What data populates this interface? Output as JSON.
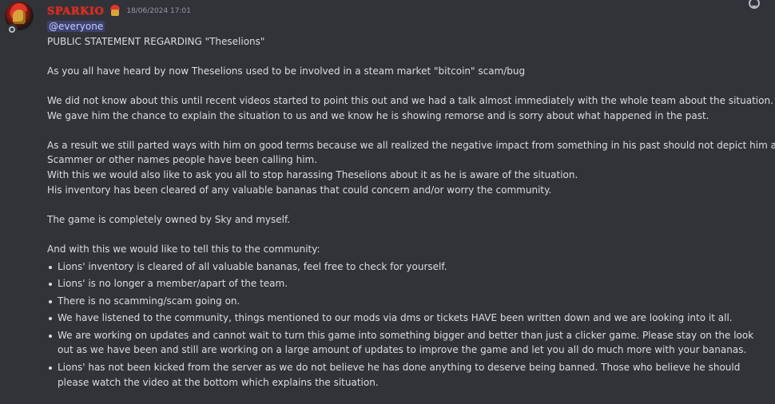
{
  "message": {
    "username": "SPARKIO",
    "timestamp": "18/06/2024 17:01",
    "mention": "@everyone",
    "title": "PUBLIC STATEMENT REGARDING \"Theselions\"",
    "para1": "As you all have heard by now Theselions used to be involved in a steam market \"bitcoin\" scam/bug",
    "para2_line1": "We did not know about this until recent videos started to point this out and we had a talk almost immediately with the whole team about the situation.",
    "para2_line2": "We gave him the chance to explain the situation to us and we know he is showing remorse and is sorry about what happened in the past.",
    "para3_line1": "As a result we still parted ways with him on good terms because we all realized the negative impact from something in his past should not depict him as a",
    "para3_line2": "Scammer or other names people have been calling him.",
    "para3_line3": "With this we would also like to ask you all to stop harassing Theselions about it as he is aware of the situation.",
    "para3_line4": "His inventory has been cleared of any valuable bananas that could concern and/or worry the community.",
    "para4": "The game is completely owned by Sky and myself.",
    "para5": "And with this we would like to tell this to the community:",
    "bullets": [
      "Lions' inventory is cleared of all valuable bananas, feel free to check for yourself.",
      "Lions' is no longer a member/apart of the team.",
      "There is no scamming/scam going on.",
      "We have listened to the community, things mentioned to our mods via dms or tickets HAVE been written down and we are looking into it all.",
      "We are working on updates and cannot wait to turn this game into something bigger and better than just a clicker game. Please stay on the look out as we have been and still are working on a large amount of updates to improve the game and let you all do much more with your bananas.",
      "Lions' has not been kicked from the server as we do not believe he has done anything to deserve being banned. Those who believe he should please watch the video at the bottom which explains the situation."
    ]
  },
  "icons": {
    "avatar": "spartan-helmet-avatar",
    "role": "spartan-helmet-icon",
    "reaction": "add-reaction-icon"
  },
  "colors": {
    "background": "#313338",
    "username": "#e8241b",
    "text": "#dbdee1",
    "timestamp": "#949ba4",
    "mention_bg": "#3c4270"
  }
}
